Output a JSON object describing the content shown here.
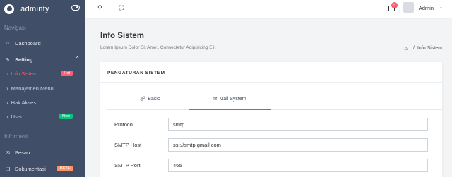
{
  "brand": {
    "name": "adminty"
  },
  "sidebar": {
    "section_navigasi": "Navigasi",
    "dashboard": "Dashboard",
    "setting": "Setting",
    "sub_items": [
      {
        "label": "Info Sistem",
        "badge": "Hot"
      },
      {
        "label": "Manajemen Menu"
      },
      {
        "label": "Hak Akses"
      },
      {
        "label": "User",
        "badge": "New"
      }
    ],
    "section_informasi": "Informasi",
    "pesan": "Pesan",
    "dokumentasi": "Dokumentasi",
    "dokumentasi_badge": "BETA"
  },
  "header": {
    "notif_count": "5",
    "user_name": "Admin"
  },
  "page": {
    "title": "Info Sistem",
    "subtitle": "Lorem Ipsum Dolor Sit Amet, Consectetur Adipisicing Elit",
    "breadcrumb_sep": "/",
    "breadcrumb_current": "Info Sistem"
  },
  "card": {
    "title": "PENGATURAN SISTEM",
    "tabs": [
      {
        "label": "Basic"
      },
      {
        "label": "Mail System"
      }
    ],
    "fields": [
      {
        "label": "Protocol",
        "value": "smtp"
      },
      {
        "label": "SMTP Host",
        "value": "ssl://smtp.gmail.com"
      },
      {
        "label": "SMTP Port",
        "value": "465"
      }
    ]
  },
  "colors": {
    "sidebar": "#404e67",
    "accent": "#01a9ac",
    "active_menu": "#ff5370",
    "badge_hot": "#fe5d70",
    "badge_new": "#0ac282",
    "badge_beta": "#fe9365"
  }
}
